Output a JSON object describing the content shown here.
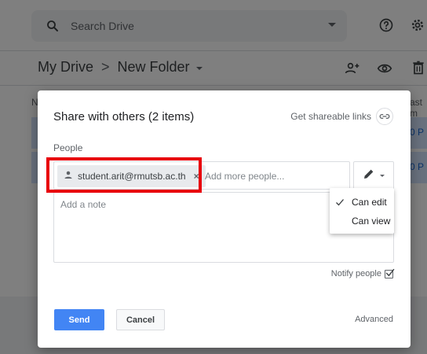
{
  "search": {
    "placeholder": "Search Drive"
  },
  "icons": {
    "search": "search-icon",
    "search_dropdown": "caret-down-icon",
    "help": "help-circle-icon",
    "settings": "gear-icon",
    "share_person": "person-add-icon",
    "preview": "eye-icon",
    "trash": "trash-icon",
    "link": "link-icon",
    "chip_person": "person-icon",
    "edit": "pencil-icon",
    "check": "check-icon",
    "notify_checkbox": "checked-checkbox-icon"
  },
  "breadcrumb": {
    "root": "My Drive",
    "separator": ">",
    "folder": "New Folder"
  },
  "background": {
    "col_left": "N",
    "col_right": "ast m",
    "rows": [
      "00 P",
      "00 P"
    ]
  },
  "dialog": {
    "title": "Share with others (2 items)",
    "shareable_links_label": "Get shareable links",
    "people_label": "People",
    "chip_email": "student.arit@rmutsb.ac.th",
    "chip_remove": "×",
    "add_people_placeholder": "Add more people...",
    "note_placeholder": "Add a note",
    "permission_menu": {
      "items": [
        {
          "label": "Can edit",
          "selected": true
        },
        {
          "label": "Can view",
          "selected": false
        }
      ]
    },
    "notify_label": "Notify people",
    "notify_checked": true,
    "send_label": "Send",
    "cancel_label": "Cancel",
    "advanced_label": "Advanced"
  },
  "colors": {
    "primary_blue": "#4285f4",
    "highlight_red": "#e8000b",
    "selected_row": "#d2e3fc"
  }
}
